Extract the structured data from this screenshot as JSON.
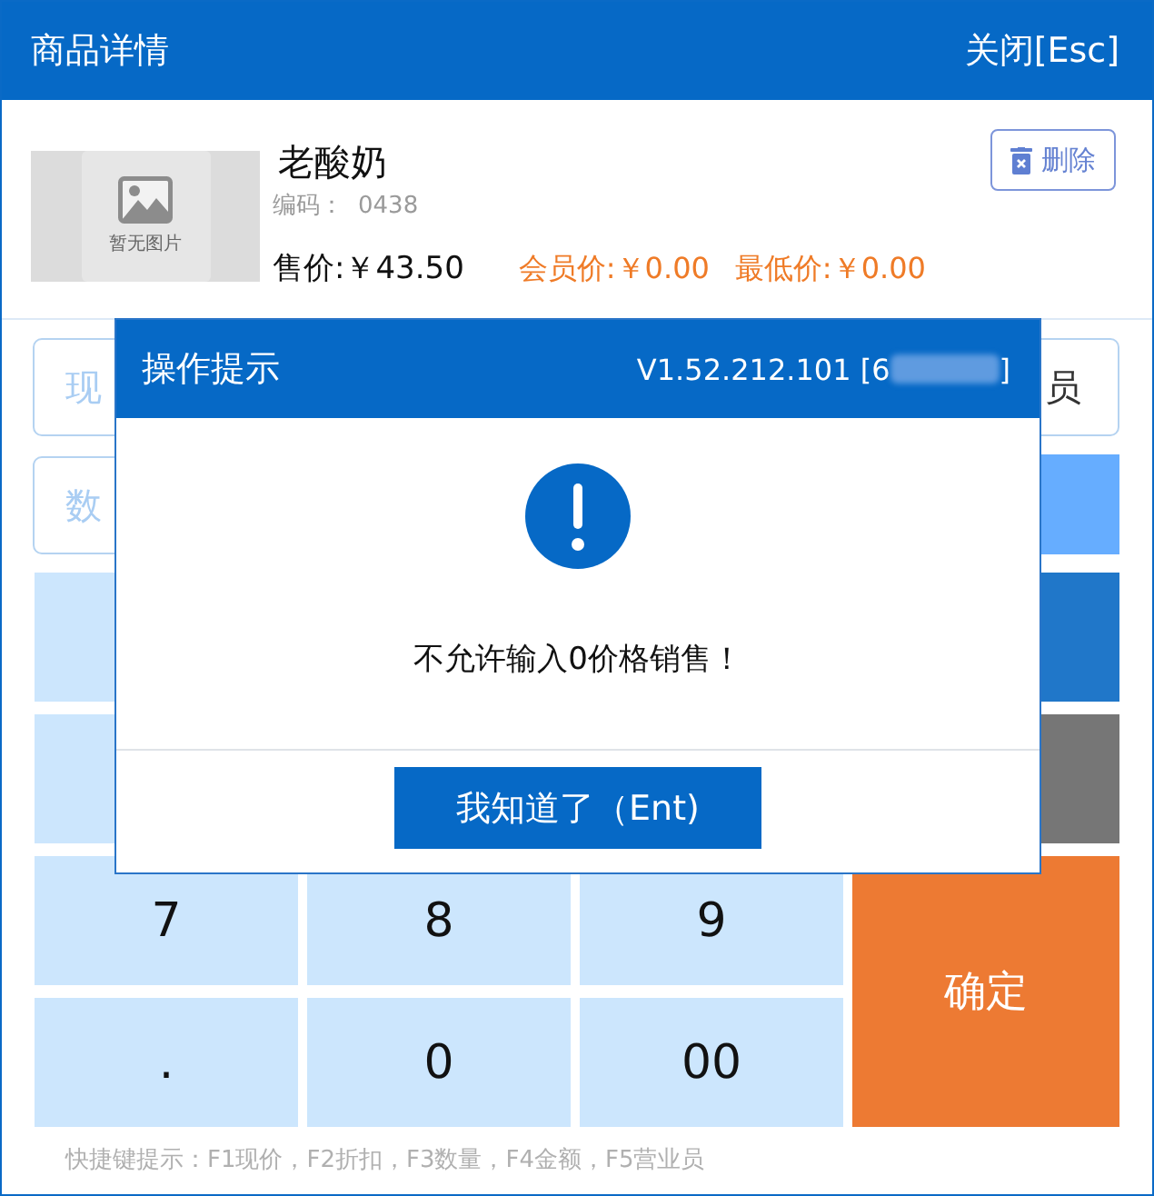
{
  "header": {
    "title": "商品详情",
    "close_button": "关闭[Esc]"
  },
  "product": {
    "image_placeholder": "暂无图片",
    "name": "老酸奶",
    "code_label": "编码：",
    "code": "0438",
    "prices": [
      {
        "kind": "sale",
        "text": "售价:￥43.50"
      },
      {
        "kind": "member",
        "text": "会员价:￥0.00"
      },
      {
        "kind": "lowest",
        "text": "最低价:￥0.00"
      }
    ],
    "delete_button": "删除"
  },
  "form_rows": [
    [
      {
        "kind": "input",
        "placeholder": "现"
      },
      {
        "kind": "select",
        "value": "员"
      }
    ],
    [
      {
        "kind": "input",
        "placeholder": "数"
      },
      {
        "kind": "button"
      }
    ]
  ],
  "keypad": {
    "number_rows": [
      [
        {
          "kind": "digit"
        }
      ],
      [
        {
          "kind": "digit"
        }
      ],
      [
        {
          "kind": "digit",
          "label": "7"
        },
        {
          "kind": "digit",
          "label": "8"
        },
        {
          "kind": "digit",
          "label": "9"
        }
      ],
      [
        {
          "kind": "digit",
          "label": "."
        },
        {
          "kind": "digit",
          "label": "0"
        },
        {
          "kind": "digit",
          "label": "00"
        }
      ]
    ],
    "side_keys": [
      {
        "kind": "function",
        "color": "#2077c9"
      },
      {
        "kind": "function",
        "color": "#767676"
      },
      {
        "kind": "confirm",
        "label": "确定",
        "color": "#ed7a33"
      }
    ]
  },
  "shortcut_hint": "快捷键提示：F1现价，F2折扣，F3数量，F4金额，F5营业员",
  "dialog": {
    "title": "操作提示",
    "version": "V1.52.212.101 [6",
    "version_end": "]",
    "message": "不允许输入0价格销售！",
    "button": "我知道了（Ent)"
  }
}
